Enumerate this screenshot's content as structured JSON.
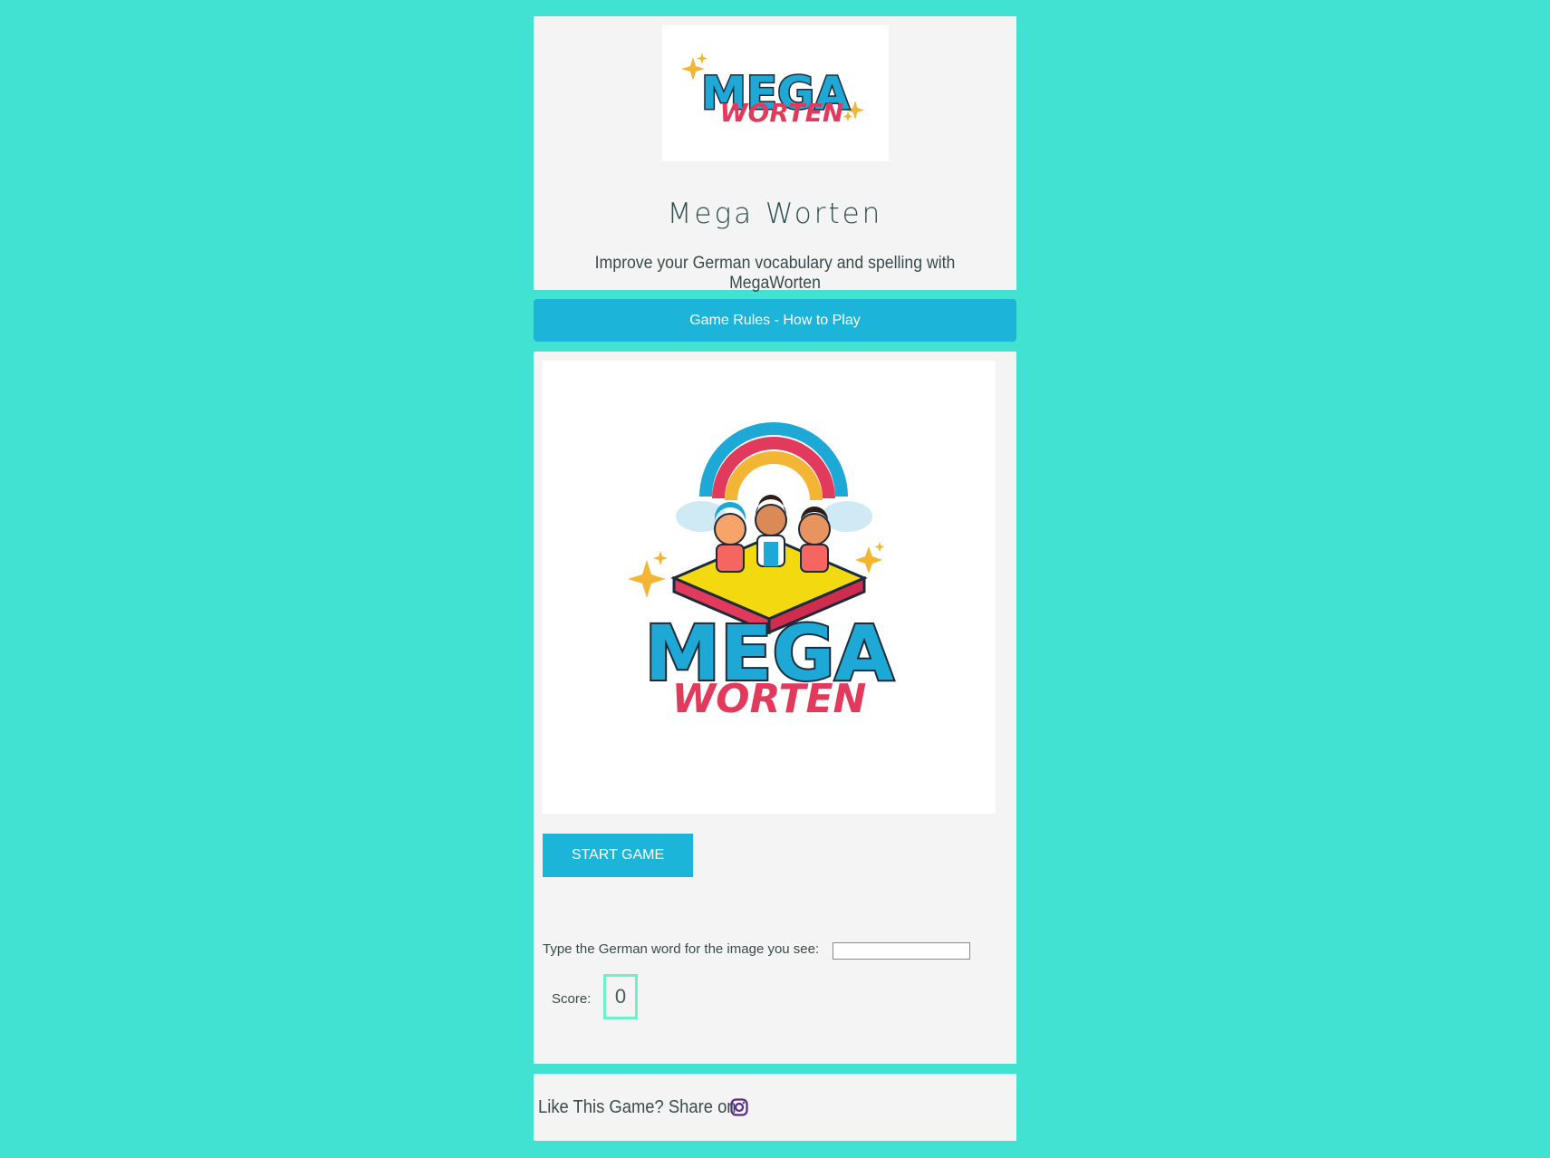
{
  "header": {
    "logo_text_top": "MEGA",
    "logo_text_bottom": "WORTEN",
    "title": "Mega Worten",
    "subtitle": "Improve your German vocabulary and spelling with MegaWorten"
  },
  "rules_button": {
    "label": "Game Rules - How to Play"
  },
  "game": {
    "hero_text_top": "MEGA",
    "hero_text_bottom": "WORTEN",
    "start_label": "START GAME",
    "prompt": "Type the German word for the image you see:",
    "answer_value": "",
    "score_label": "Score:",
    "score_value": "0"
  },
  "footer": {
    "share_text": "Like This Game? Share on",
    "share_icon": "instagram-icon"
  },
  "colors": {
    "background": "#42e2d2",
    "card": "#f4f4f4",
    "accent": "#1cb5d9",
    "logo_blue": "#1ea8d6",
    "logo_red": "#e23a5c",
    "score_border": "#6ff0c8",
    "instagram": "#5b2a86"
  }
}
